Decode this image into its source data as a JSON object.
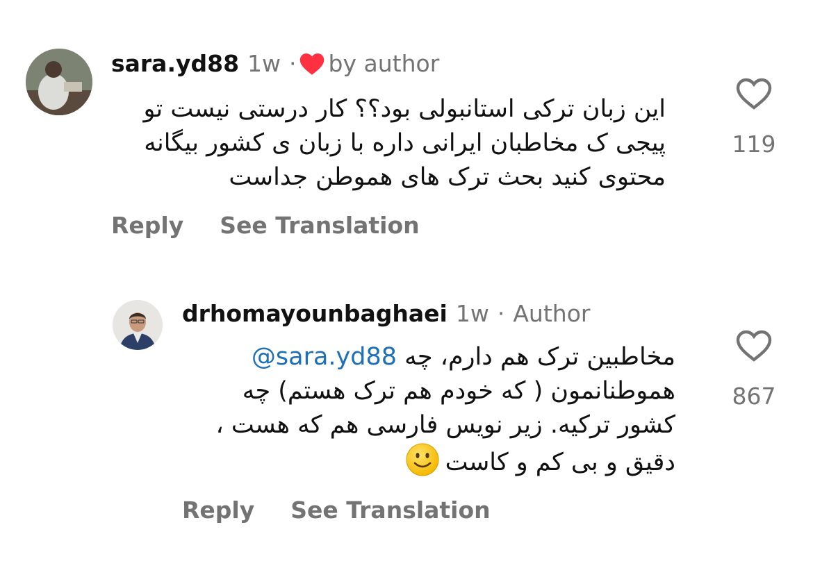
{
  "comments": [
    {
      "username": "sara.yd88",
      "time": "1w",
      "separator": "·",
      "liked_by_author_label": "by author",
      "text_lines": [
        "این زبان ترکی استانبولی بود؟؟ کار درستی نیست تو",
        "پیجی ک مخاطبان ایرانی داره با زبان ی کشور بیگانه",
        "محتوی کنید بحث ترک های هموطن جداست"
      ],
      "like_count": "119",
      "reply_label": "Reply",
      "translate_label": "See Translation"
    },
    {
      "username": "drhomayounbaghaei",
      "time": "1w",
      "separator": "·",
      "badge": "Author",
      "mention": "@sara.yd88",
      "text_line1_rest": "مخاطبین ترک هم دارم، چه",
      "text_lines": [
        "هموطنانمون ( که خودم هم ترک هستم) چه",
        "کشور ترکیه. زیر نویس فارسی هم که هست ،",
        "دقیق و بی کم و کاست"
      ],
      "emoji": "slightly-smiling-face",
      "like_count": "867",
      "reply_label": "Reply",
      "translate_label": "See Translation"
    }
  ],
  "colors": {
    "text": "#111111",
    "muted": "#737373",
    "mention": "#1d6fb8",
    "heart": "#ff3040"
  }
}
